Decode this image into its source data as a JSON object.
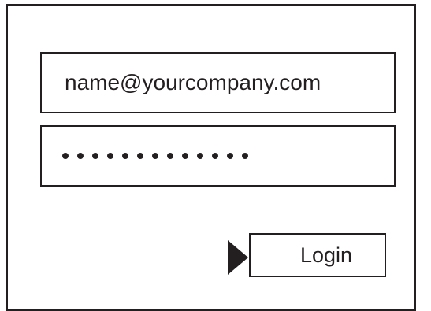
{
  "login_form": {
    "email_value": "name@yourcompany.com",
    "password_masked_length": 13,
    "login_button_label": "Login"
  },
  "icons": {
    "pointer": "triangle-pointer-icon"
  },
  "colors": {
    "stroke": "#231f20",
    "background": "#ffffff"
  }
}
